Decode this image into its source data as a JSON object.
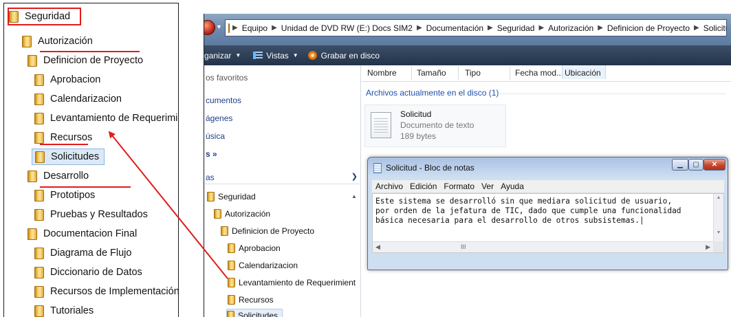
{
  "left_tree": {
    "items": [
      {
        "label": "Seguridad"
      },
      {
        "label": "Autorización"
      },
      {
        "label": "Definicion de Proyecto"
      },
      {
        "label": "Aprobacion"
      },
      {
        "label": "Calendarizacion"
      },
      {
        "label": "Levantamiento de Requerimien"
      },
      {
        "label": "Recursos"
      },
      {
        "label": "Solicitudes"
      },
      {
        "label": "Desarrollo"
      },
      {
        "label": "Prototipos"
      },
      {
        "label": "Pruebas y Resultados"
      },
      {
        "label": "Documentacion Final"
      },
      {
        "label": "Diagrama de Flujo"
      },
      {
        "label": "Diccionario de Datos"
      },
      {
        "label": "Recursos de Implementación"
      },
      {
        "label": "Tutoriales"
      }
    ]
  },
  "explorer": {
    "breadcrumb": [
      "Equipo",
      "Unidad de DVD RW (E:) Docs SIM2",
      "Documentación",
      "Seguridad",
      "Autorización",
      "Definicion de Proyecto",
      "Solicitudes"
    ],
    "toolbar": {
      "organize": "ganizar",
      "views": "Vistas",
      "burn": "Grabar en disco"
    },
    "navpane": {
      "favorites": [
        "os favoritos",
        "cumentos",
        "ágenes",
        "úsica",
        "s »"
      ],
      "folders_label": "as",
      "tree": [
        {
          "label": "Seguridad"
        },
        {
          "label": "Autorización"
        },
        {
          "label": "Definicion de Proyecto"
        },
        {
          "label": "Aprobacion"
        },
        {
          "label": "Calendarizacion"
        },
        {
          "label": "Levantamiento de Requerimient"
        },
        {
          "label": "Recursos"
        },
        {
          "label": "Solicitudes"
        }
      ]
    },
    "columns": [
      "Nombre",
      "Tamaño",
      "Tipo",
      "Fecha mod...",
      "Ubicación"
    ],
    "group_header": "Archivos actualmente en el disco (1)",
    "file": {
      "name": "Solicitud",
      "type": "Documento de texto",
      "size": "189 bytes"
    }
  },
  "notepad": {
    "title": "Solicitud - Bloc de notas",
    "menus": [
      "Archivo",
      "Edición",
      "Formato",
      "Ver",
      "Ayuda"
    ],
    "text": "Este sistema se desarrolló sin que mediara solicitud de usuario,\npor orden de la jefatura de TIC, dado que cumple una funcionalidad\nbásica necesaria para el desarrollo de otros subsistemas.|",
    "hscroll_grip": "III"
  },
  "colors": {
    "annotation_red": "#e21b1b",
    "selection_blue": "#dbe9f7",
    "folder_gold": "#f2c552"
  }
}
